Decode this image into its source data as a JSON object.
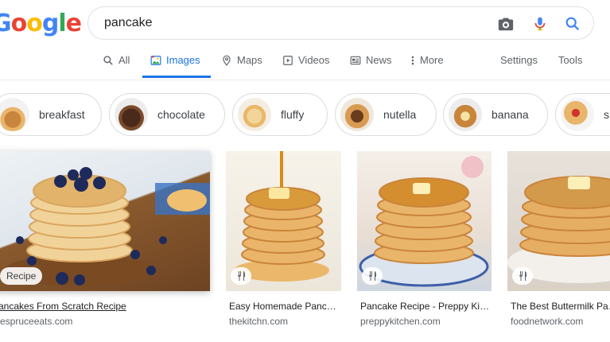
{
  "logo": {
    "text": "Google",
    "letters": [
      "G",
      "o",
      "o",
      "g",
      "l",
      "e"
    ],
    "colors": [
      "#4285f4",
      "#ea4335",
      "#fbbc05",
      "#4285f4",
      "#34a853",
      "#ea4335"
    ]
  },
  "search": {
    "query": "pancake"
  },
  "tabs": [
    {
      "label": "All",
      "icon": "search-icon"
    },
    {
      "label": "Images",
      "icon": "image-icon",
      "active": true
    },
    {
      "label": "Maps",
      "icon": "map-pin-icon"
    },
    {
      "label": "Videos",
      "icon": "play-icon"
    },
    {
      "label": "News",
      "icon": "news-icon"
    },
    {
      "label": "More",
      "icon": "more-vert-icon"
    }
  ],
  "tools": {
    "settings": "Settings",
    "tools": "Tools"
  },
  "chips": [
    {
      "label": "breakfast"
    },
    {
      "label": "chocolate"
    },
    {
      "label": "fluffy"
    },
    {
      "label": "nutella"
    },
    {
      "label": "banana"
    },
    {
      "label": "s"
    }
  ],
  "results": [
    {
      "title": "Pancakes From Scratch Recipe",
      "source": "thespruceeats.com",
      "badge": "Recipe"
    },
    {
      "title": "Easy Homemade Panc…",
      "source": "thekitchn.com"
    },
    {
      "title": "Pancake Recipe - Preppy Ki…",
      "source": "preppykitchen.com"
    },
    {
      "title": "The Best Buttermilk Pa…",
      "source": "foodnetwork.com"
    }
  ],
  "colors": {
    "accent": "#1a73e8"
  }
}
